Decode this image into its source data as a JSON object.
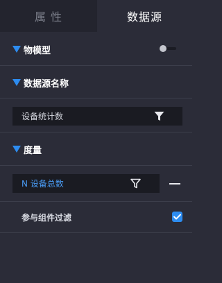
{
  "tabs": [
    {
      "label": "属 性",
      "active": false
    },
    {
      "label": "数据源",
      "active": true
    }
  ],
  "sections": {
    "model": {
      "title": "物模型",
      "toggle_on": false
    },
    "datasource_name": {
      "title": "数据源名称",
      "field_value": "设备统计数"
    },
    "measure": {
      "title": "度量",
      "field_value": "N 设备总数"
    }
  },
  "filter_option": {
    "label": "参与组件过滤",
    "checked": true
  },
  "icons": [
    "triangle-down-icon",
    "filter-icon",
    "minus-icon",
    "check-icon",
    "toggle-switch"
  ],
  "colors": {
    "accent": "#2d8cf0",
    "panel_bg": "#2b2c38",
    "inactive_tab_bg": "#23242e",
    "field_bg": "#1a1b22",
    "measure_text": "#4a9cf5"
  }
}
